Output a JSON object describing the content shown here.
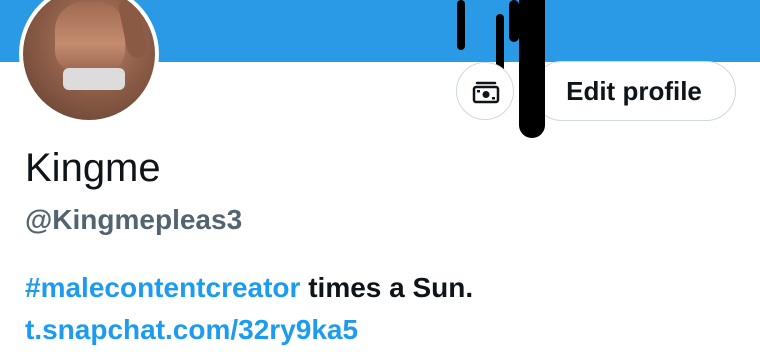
{
  "profile": {
    "display_name": "Kingme",
    "handle": "@Kingmepleas3",
    "bio_hashtag": "#malecontentcreator",
    "bio_text": " times a Sun.",
    "link": "t.snapchat.com/32ry9ka5"
  },
  "actions": {
    "edit_profile_label": "Edit profile",
    "money_icon": "money-icon"
  },
  "colors": {
    "banner": "#2a9ae6",
    "link": "#1d9bf0",
    "handle": "#536471",
    "text": "#0f1419"
  }
}
